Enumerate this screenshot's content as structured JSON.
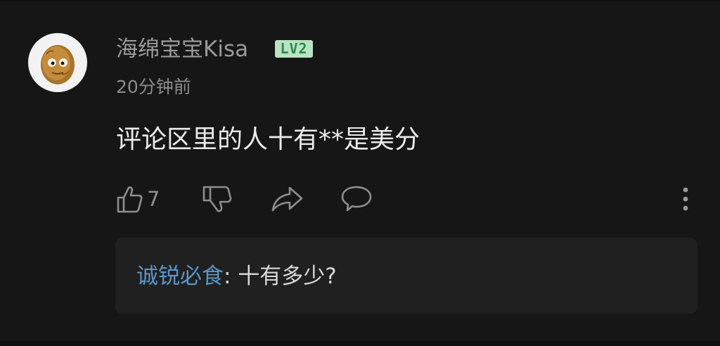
{
  "comment": {
    "username": "海绵宝宝Kisa",
    "level_badge": "LV2",
    "timestamp": "20分钟前",
    "text": "评论区里的人十有**是美分",
    "avatar_icon": "wall-nut-icon"
  },
  "actions": {
    "like_count": "7",
    "like_icon": "thumbs-up-icon",
    "dislike_icon": "thumbs-down-icon",
    "share_icon": "share-icon",
    "reply_icon": "comment-bubble-icon",
    "more_icon": "more-vertical-icon"
  },
  "reply": {
    "author": "诚锐必食",
    "separator": ":",
    "text": " 十有多少?"
  },
  "colors": {
    "background": "#161616",
    "reply_box": "#202020",
    "reply_author": "#5b95c8",
    "level_badge_bg": "#b9e3c3",
    "level_badge_text": "#2f8a4a"
  }
}
